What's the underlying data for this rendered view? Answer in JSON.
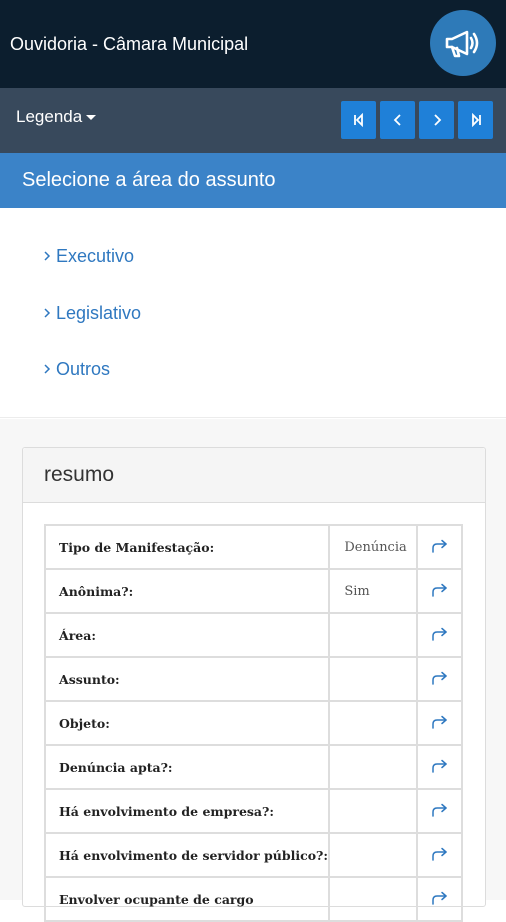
{
  "header": {
    "title": "Ouvidoria - Câmara Municipal",
    "action_icon": "megaphone-icon"
  },
  "toolbar": {
    "legend_label": "Legenda",
    "nav": [
      {
        "name": "first-page-button",
        "icon": "skip-first-icon"
      },
      {
        "name": "prev-page-button",
        "icon": "chevron-left-icon"
      },
      {
        "name": "next-page-button",
        "icon": "chevron-right-icon"
      },
      {
        "name": "last-page-button",
        "icon": "skip-last-icon"
      }
    ]
  },
  "section": {
    "title": "Selecione a área do assunto"
  },
  "areas": [
    {
      "label": "Executivo"
    },
    {
      "label": "Legislativo"
    },
    {
      "label": "Outros"
    }
  ],
  "summary": {
    "title": "resumo",
    "rows": [
      {
        "label": "Tipo de Manifestação:",
        "value": "Denúncia"
      },
      {
        "label": "Anônima?:",
        "value": "Sim"
      },
      {
        "label": "Área:",
        "value": ""
      },
      {
        "label": "Assunto:",
        "value": ""
      },
      {
        "label": "Objeto:",
        "value": ""
      },
      {
        "label": "Denúncia apta?:",
        "value": ""
      },
      {
        "label": "Há envolvimento de empresa?:",
        "value": ""
      },
      {
        "label": "Há envolvimento de servidor público?:",
        "value": ""
      },
      {
        "label": "Envolver ocupante de cargo",
        "value": ""
      }
    ]
  },
  "colors": {
    "topbar": "#0c1e2e",
    "subbar": "#38495c",
    "accent": "#3b83c8",
    "nav_button": "#1f80d8",
    "link": "#2f78c0"
  }
}
